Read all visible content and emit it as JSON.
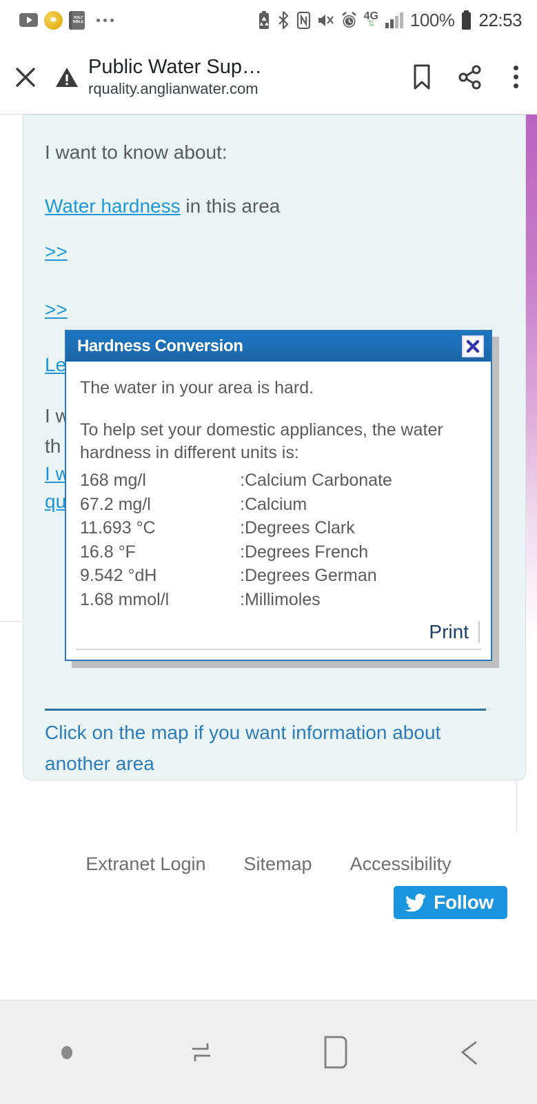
{
  "statusbar": {
    "notifications": [
      {
        "name": "youtube-icon",
        "label": ""
      },
      {
        "name": "app-gold-icon",
        "label": "P"
      },
      {
        "name": "holy-bible-icon",
        "label": "HOLY BIBLE"
      },
      {
        "name": "more-notifications-icon",
        "label": ""
      }
    ],
    "system": {
      "battery_saver": "battery-saver-icon",
      "bluetooth": "bluetooth-icon",
      "nfc": "nfc-icon",
      "mute": "mute-icon",
      "alarm": "alarm-icon",
      "network": "4G",
      "network_sub": "data-arrows-icon",
      "signal": "signal-bars-icon",
      "battery_percent": "100%",
      "battery": "battery-icon",
      "time": "22:53"
    }
  },
  "browserbar": {
    "close_label": "×",
    "security": "warning-triangle-icon",
    "title": "Public Water Sup…",
    "url": "rquality.anglianwater.com",
    "bookmark": "bookmark-icon",
    "share": "share-icon",
    "menu": "overflow-menu-icon"
  },
  "page": {
    "intro": "I want to know about:",
    "hardness_link": "Water hardness",
    "hardness_rest": " in this area",
    "obscured": [
      ">>",
      ">>",
      "Le",
      "I w",
      "th",
      "I w",
      "qu"
    ],
    "bottom_link_line1": "Click on the map if you want information about",
    "bottom_link_line2": "another area"
  },
  "dialog": {
    "title": "Hardness Conversion",
    "close_label": "✖",
    "statement": "The water in your area is hard.",
    "intro_line1": "To help set your domestic appliances, the water",
    "intro_line2": "hardness in different units is:",
    "units": [
      {
        "value": "168 mg/l",
        "label": ":Calcium Carbonate"
      },
      {
        "value": "67.2 mg/l",
        "label": ":Calcium"
      },
      {
        "value": "11.693 °C",
        "label": ":Degrees Clark"
      },
      {
        "value": "16.8 °F",
        "label": ":Degrees French"
      },
      {
        "value": "9.542 °dH",
        "label": ":Degrees German"
      },
      {
        "value": "1.68 mmol/l",
        "label": ":Millimoles"
      }
    ],
    "print_label": "Print"
  },
  "footer": {
    "links": [
      "Extranet Login",
      "Sitemap",
      "Accessibility"
    ],
    "twitter_label": "Follow"
  },
  "navbar": {
    "dot": "dot-indicator",
    "recents": "recents-icon",
    "home": "home-icon",
    "back": "back-icon"
  },
  "colors": {
    "dialog_title_blue": "#1d6fb4",
    "link_blue": "#2196d6",
    "panel_bg": "#eaf4f4",
    "twitter_blue": "#1b95e0",
    "map_purple": "#b963c0"
  }
}
